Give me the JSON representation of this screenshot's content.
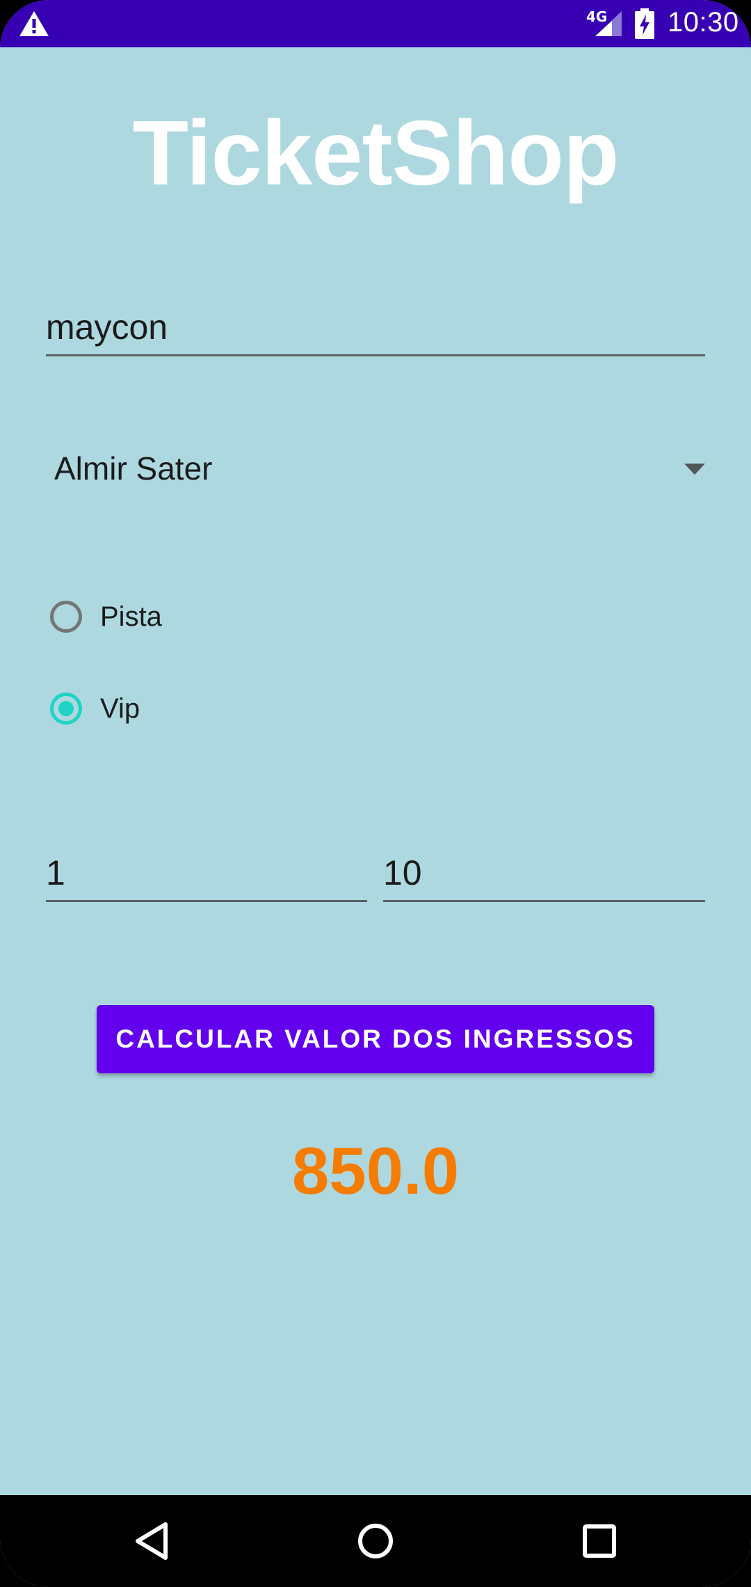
{
  "status_bar": {
    "network": "4G",
    "time": "10:30"
  },
  "app": {
    "title": "TicketShop"
  },
  "form": {
    "name_value": "maycon",
    "artist_selected": "Almir Sater",
    "ticket_types": [
      {
        "label": "Pista",
        "checked": false
      },
      {
        "label": "Vip",
        "checked": true
      }
    ],
    "quantity_value": "1",
    "second_value": "10",
    "calculate_label": "CALCULAR VALOR DOS INGRESSOS",
    "result": "850.0"
  },
  "colors": {
    "status_bar": "#3700b3",
    "background": "#add8e0",
    "button": "#6200ee",
    "radio_accent": "#1fd4c4",
    "result": "#f57c00"
  },
  "icons": {
    "status": [
      "warning-icon",
      "signal-icon",
      "battery-charging-icon"
    ],
    "nav": [
      "back-icon",
      "home-icon",
      "recent-apps-icon"
    ]
  }
}
